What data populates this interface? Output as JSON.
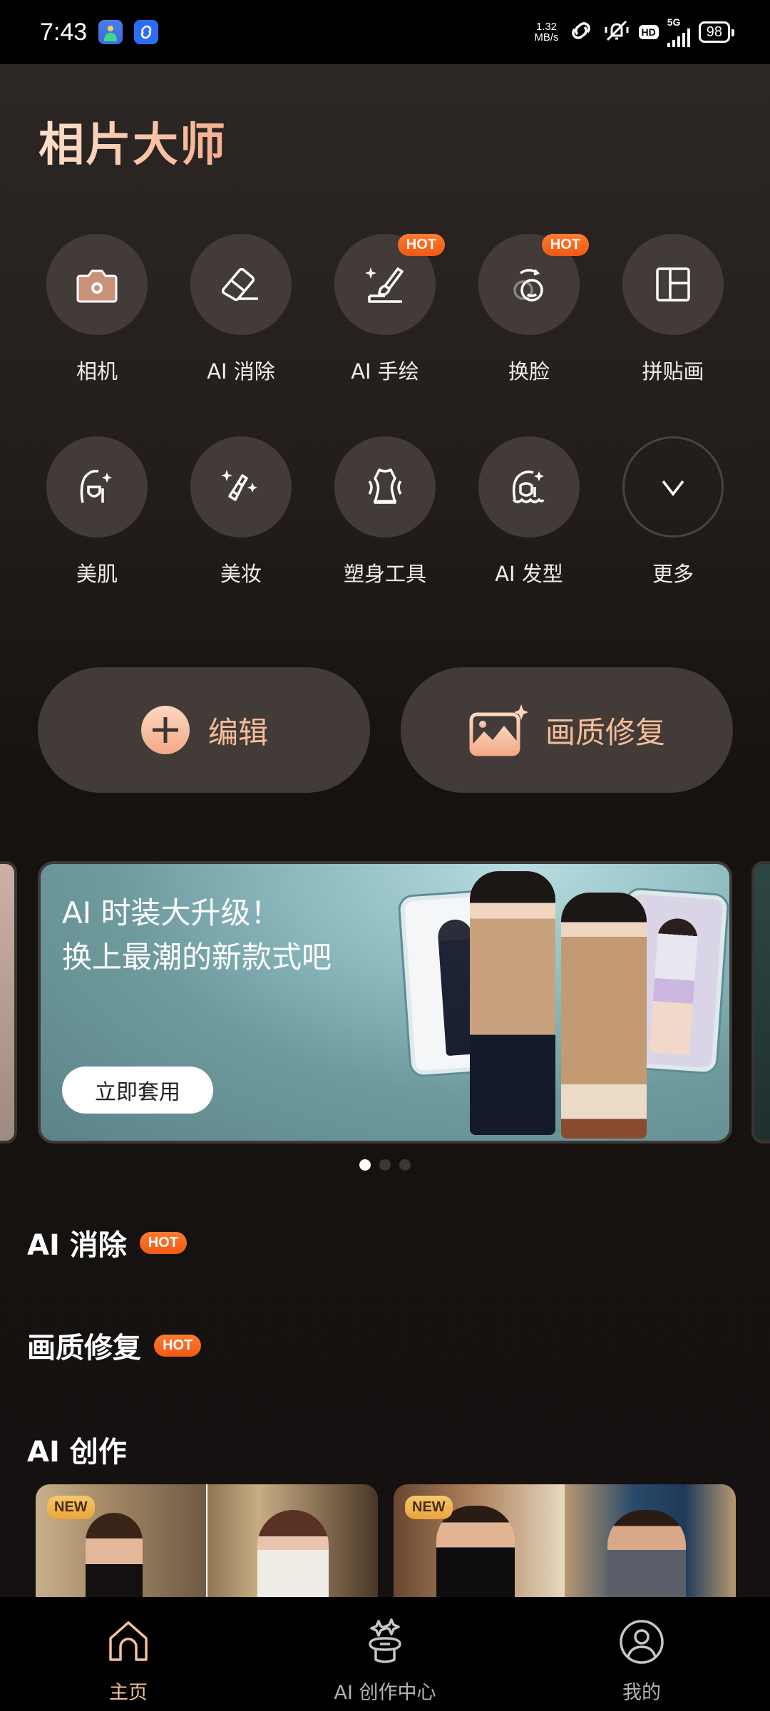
{
  "status_bar": {
    "time": "7:43",
    "net_speed_value": "1.32",
    "net_speed_unit": "MB/s",
    "hd_label": "HD",
    "network_type": "5G",
    "battery": "98",
    "notification_icons": [
      "app-installer-icon",
      "link-app-icon"
    ],
    "system_icons": [
      "link-icon",
      "mute-icon",
      "hd-icon",
      "signal-icon",
      "battery-icon"
    ]
  },
  "app": {
    "title": "相片大师"
  },
  "tools": {
    "row1": [
      {
        "label": "相机",
        "icon": "camera-icon",
        "badge": null
      },
      {
        "label": "AI 消除",
        "icon": "eraser-icon",
        "badge": null
      },
      {
        "label": "AI 手绘",
        "icon": "paint-brush-icon",
        "badge": "HOT"
      },
      {
        "label": "换脸",
        "icon": "face-swap-icon",
        "badge": "HOT"
      },
      {
        "label": "拼贴画",
        "icon": "collage-icon",
        "badge": null
      }
    ],
    "row2": [
      {
        "label": "美肌",
        "icon": "skin-beauty-icon",
        "badge": null
      },
      {
        "label": "美妆",
        "icon": "makeup-icon",
        "badge": null
      },
      {
        "label": "塑身工具",
        "icon": "body-shape-icon",
        "badge": null
      },
      {
        "label": "AI 发型",
        "icon": "hairstyle-icon",
        "badge": null
      },
      {
        "label": "更多",
        "icon": "chevron-down-icon",
        "badge": null
      }
    ]
  },
  "actions": {
    "edit_label": "编辑",
    "restore_label": "画质修复"
  },
  "banner": {
    "line1": "AI 时装大升级！",
    "line2": "换上最潮的新款式吧",
    "cta": "立即套用",
    "page_count": 3,
    "active_page": 1
  },
  "sections": {
    "ai_erase": {
      "title": "AI 消除",
      "badge": "HOT"
    },
    "quality_restore": {
      "title": "画质修复",
      "badge": "HOT"
    },
    "ai_creation": {
      "title": "AI 创作"
    }
  },
  "creation_cards": [
    {
      "badge": "NEW"
    },
    {
      "badge": "NEW"
    }
  ],
  "bottom_nav": [
    {
      "label": "主页",
      "icon": "home-icon",
      "active": true
    },
    {
      "label": "AI 创作中心",
      "icon": "magic-hat-icon",
      "active": false
    },
    {
      "label": "我的",
      "icon": "profile-icon",
      "active": false
    }
  ],
  "colors": {
    "accent": "#f6bd9a",
    "hot_badge": "#f05a14",
    "new_badge": "#e9a53c",
    "tool_circle": "#433b38"
  }
}
